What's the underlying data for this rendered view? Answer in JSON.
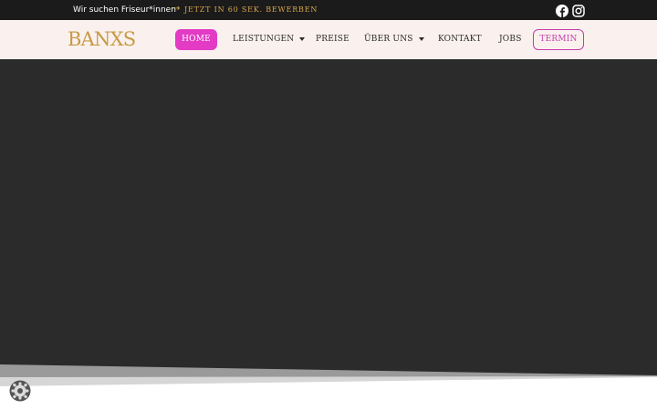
{
  "topbar": {
    "hiring_text": "Wir suchen Friseur*innen",
    "arrow": "→",
    "apply_link": "Jetzt in 60 Sek. bewerben",
    "social": [
      "facebook-icon",
      "instagram-icon"
    ]
  },
  "header": {
    "logo": "BANXS",
    "nav": {
      "home": "HOME",
      "leistungen": "LEISTUNGEN",
      "preise": "PREISE",
      "ueber_uns": "ÜBER UNS",
      "kontakt": "KONTAKT",
      "jobs": "JOBS",
      "termin": "TERMIN"
    }
  },
  "colors": {
    "topbar_bg": "#1b1b1b",
    "header_bg": "#faf1ee",
    "accent_pink": "#e33bc4",
    "gold": "#c89a45",
    "hero_bg": "#2b2b2b"
  }
}
